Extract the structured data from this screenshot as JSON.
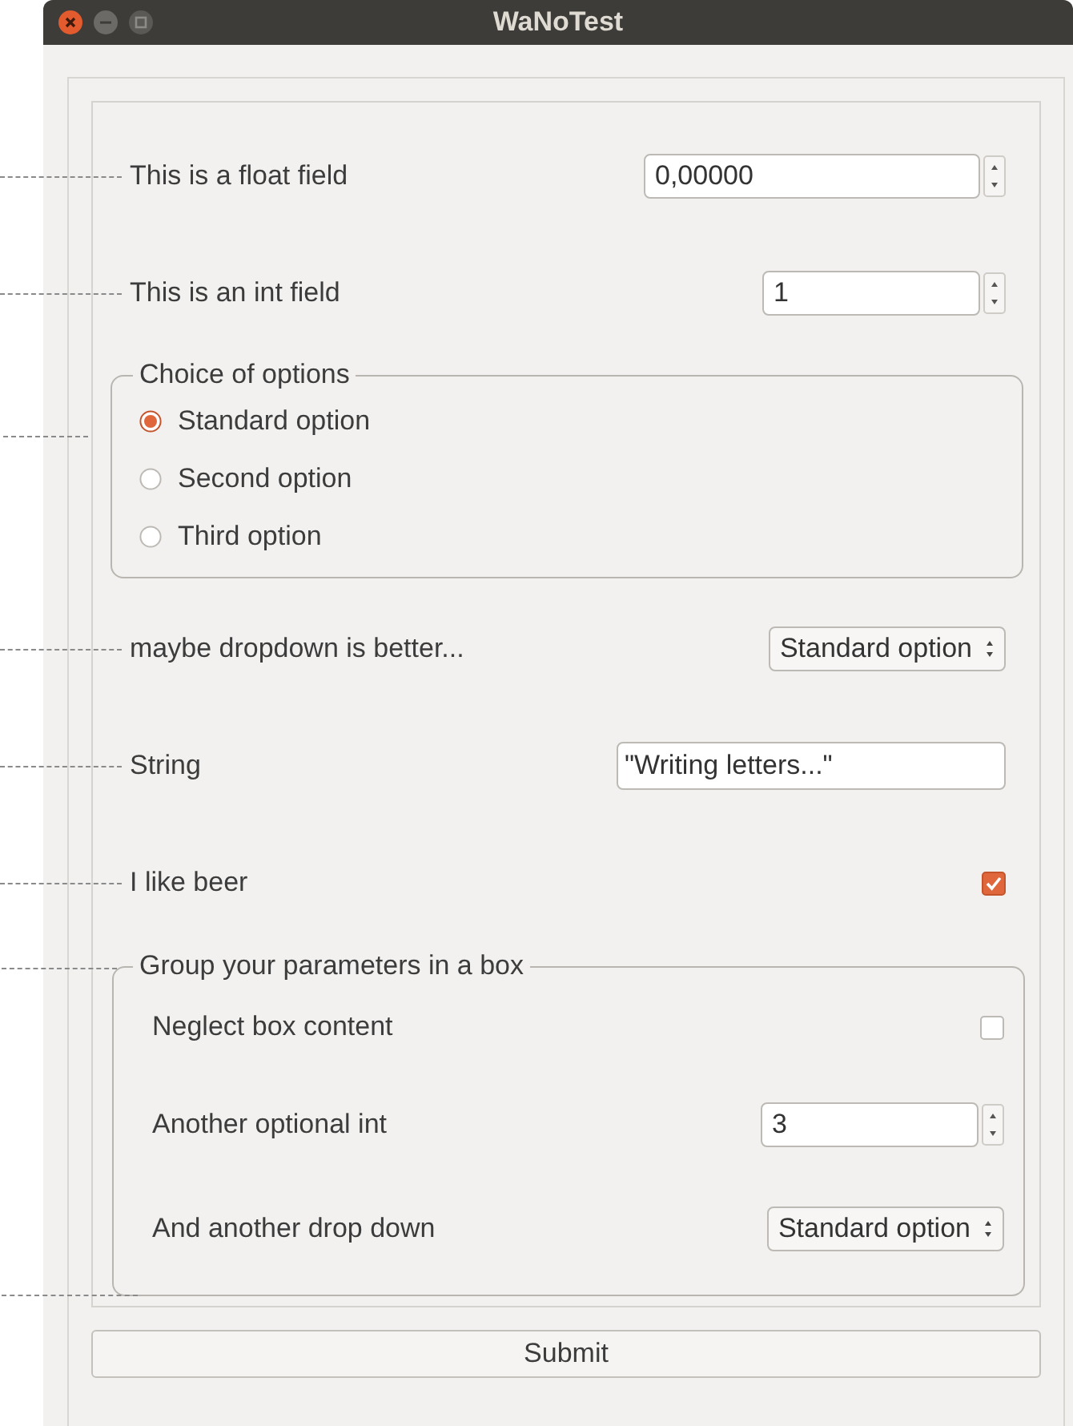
{
  "window": {
    "title": "WaNoTest"
  },
  "fields": [
    {
      "kind": "float",
      "label": "This is a float field",
      "value": "0,00000"
    },
    {
      "kind": "int",
      "label": "This is an int field",
      "value": "1"
    },
    {
      "kind": "radio_group",
      "title": "Choice of options",
      "options": [
        {
          "label": "Standard option",
          "selected": true
        },
        {
          "label": "Second option",
          "selected": false
        },
        {
          "label": "Third option",
          "selected": false
        }
      ]
    },
    {
      "kind": "dropdown",
      "label": "maybe dropdown is better...",
      "value": "Standard option"
    },
    {
      "kind": "string",
      "label": "String",
      "value": "\"Writing letters...\""
    },
    {
      "kind": "checkbox",
      "label": "I like beer",
      "checked": true
    },
    {
      "kind": "group",
      "title": "Group your parameters in a box",
      "children": [
        {
          "kind": "checkbox",
          "label": "Neglect box content",
          "checked": false
        },
        {
          "kind": "int",
          "label": "Another optional int",
          "value": "3"
        },
        {
          "kind": "dropdown",
          "label": "And another drop down",
          "value": "Standard option"
        }
      ]
    }
  ],
  "submit": "Submit"
}
